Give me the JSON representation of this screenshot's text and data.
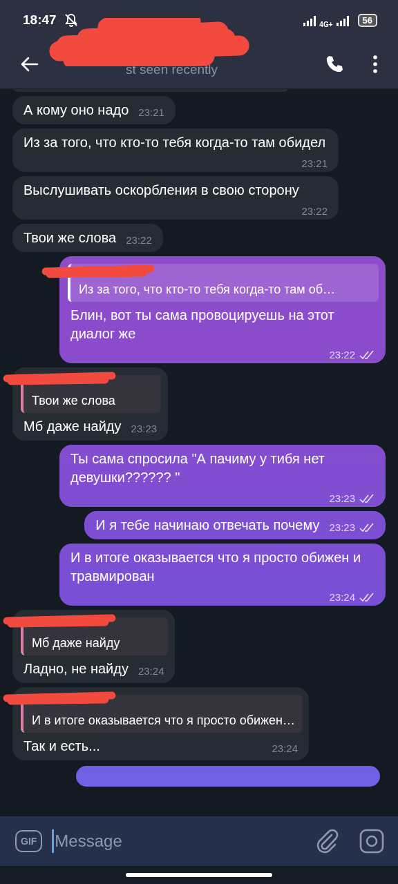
{
  "status_bar": {
    "time": "18:47",
    "battery": "56",
    "network": "4G+"
  },
  "header": {
    "name_redacted": true,
    "status": "st seen recently"
  },
  "messages": [
    {
      "kind": "incoming",
      "text": "А кому оно надо",
      "time": "23:21"
    },
    {
      "kind": "incoming",
      "text": "Из за того, что кто-то тебя когда-то там обидел",
      "time": "23:21"
    },
    {
      "kind": "incoming",
      "text": "Выслушивать оскорбления в свою сторону",
      "time": "23:22"
    },
    {
      "kind": "incoming",
      "text": "Твои же слова",
      "time": "23:22"
    },
    {
      "kind": "outgoing",
      "reply": {
        "name_redacted": true,
        "text": "Из за того, что кто-то тебя когда-то там об…"
      },
      "text": "Блин, вот ты сама провоцируешь на этот диалог же",
      "time": "23:22",
      "read": true
    },
    {
      "kind": "incoming",
      "reply": {
        "name_redacted": true,
        "text": "Твои же слова"
      },
      "text": "Мб даже найду",
      "time": "23:23"
    },
    {
      "kind": "outgoing",
      "text": "Ты сама спросила \"А пачиму у тибя нет девушки?????? \"",
      "time": "23:23",
      "read": true
    },
    {
      "kind": "outgoing",
      "text": "И я тебе начинаю отвечать почему",
      "time": "23:23",
      "read": true
    },
    {
      "kind": "outgoing",
      "text": "И в итоге оказывается что я просто обижен и травмирован",
      "time": "23:24",
      "read": true
    },
    {
      "kind": "incoming",
      "reply": {
        "name_redacted": true,
        "text": "Мб даже найду"
      },
      "text": "Ладно, не найду",
      "time": "23:24"
    },
    {
      "kind": "incoming",
      "reply": {
        "name_redacted": true,
        "text": "И в итоге оказывается что я просто обижен…"
      },
      "text": "Так и есть...",
      "time": "23:24"
    }
  ],
  "composer": {
    "gif": "GIF",
    "placeholder": "Message"
  }
}
